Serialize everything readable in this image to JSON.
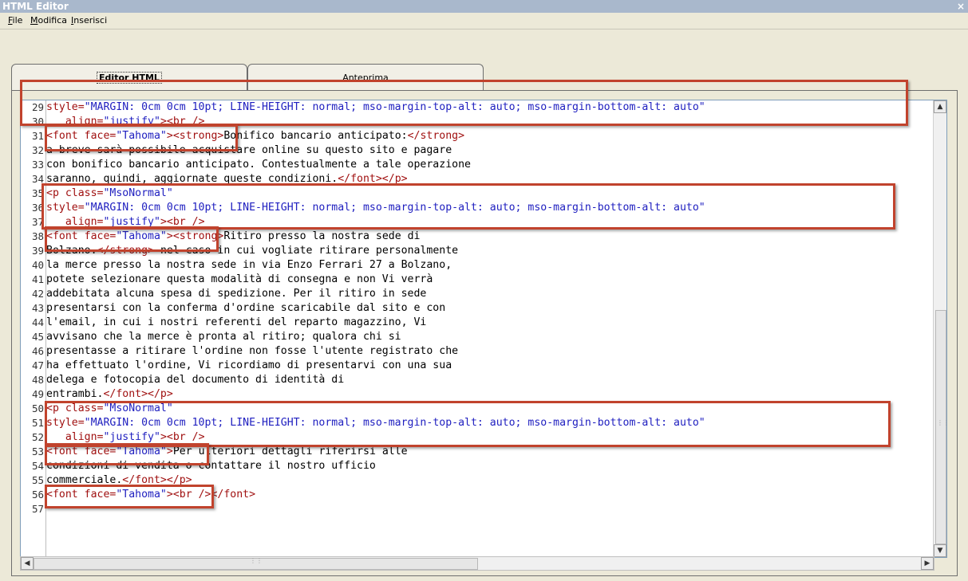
{
  "window": {
    "title": "HTML Editor",
    "close_glyph": "×"
  },
  "menu": [
    "File",
    "Modifica",
    "Inserisci"
  ],
  "tabs": [
    {
      "label": "Editor HTML",
      "active": true
    },
    {
      "label": "Anteprima",
      "active": false
    }
  ],
  "scroll": {
    "up": "▲",
    "down": "▼",
    "left": "◀",
    "right": "▶",
    "grip": "⋮⋮"
  },
  "editor_lines": [
    {
      "num": "29",
      "segs": [
        {
          "c": "attr",
          "t": "style="
        },
        {
          "c": "val",
          "t": "\"MARGIN: 0cm 0cm 10pt; LINE-HEIGHT: normal; mso-margin-top-alt: auto; mso-margin-bottom-alt: auto\""
        }
      ]
    },
    {
      "num": "30",
      "segs": [
        {
          "c": "attr",
          "t": "   align="
        },
        {
          "c": "val",
          "t": "\"justify\""
        },
        {
          "c": "tag",
          "t": "><br />"
        }
      ]
    },
    {
      "num": "31",
      "segs": [
        {
          "c": "tag",
          "t": "<font "
        },
        {
          "c": "attr",
          "t": "face="
        },
        {
          "c": "val",
          "t": "\"Tahoma\""
        },
        {
          "c": "tag",
          "t": "><strong>"
        },
        {
          "c": "txt",
          "t": "Bonifico bancario anticipato:"
        },
        {
          "c": "tag",
          "t": "</strong>"
        }
      ]
    },
    {
      "num": "32",
      "segs": [
        {
          "c": "txt",
          "t": "a breve sarà possibile acquistare online su questo sito e pagare"
        }
      ]
    },
    {
      "num": "33",
      "segs": [
        {
          "c": "txt",
          "t": "con bonifico bancario anticipato. Contestualmente a tale operazione"
        }
      ]
    },
    {
      "num": "34",
      "segs": [
        {
          "c": "txt",
          "t": "saranno, quindi, aggiornate queste condizioni."
        },
        {
          "c": "tag",
          "t": "</font></p>"
        }
      ]
    },
    {
      "num": "35",
      "segs": [
        {
          "c": "tag",
          "t": "<p "
        },
        {
          "c": "attr",
          "t": "class="
        },
        {
          "c": "val",
          "t": "\"MsoNormal\""
        }
      ]
    },
    {
      "num": "36",
      "segs": [
        {
          "c": "attr",
          "t": "style="
        },
        {
          "c": "val",
          "t": "\"MARGIN: 0cm 0cm 10pt; LINE-HEIGHT: normal; mso-margin-top-alt: auto; mso-margin-bottom-alt: auto\""
        }
      ]
    },
    {
      "num": "37",
      "segs": [
        {
          "c": "attr",
          "t": "   align="
        },
        {
          "c": "val",
          "t": "\"justify\""
        },
        {
          "c": "tag",
          "t": "><br />"
        }
      ]
    },
    {
      "num": "38",
      "segs": [
        {
          "c": "tag",
          "t": "<font "
        },
        {
          "c": "attr",
          "t": "face="
        },
        {
          "c": "val",
          "t": "\"Tahoma\""
        },
        {
          "c": "tag",
          "t": "><strong>"
        },
        {
          "c": "txt",
          "t": "Ritiro presso la nostra sede di"
        }
      ]
    },
    {
      "num": "39",
      "segs": [
        {
          "c": "txt",
          "t": "Bolzano."
        },
        {
          "c": "tag",
          "t": "</strong>"
        },
        {
          "c": "txt",
          "t": " nel caso in cui vogliate ritirare personalmente"
        }
      ]
    },
    {
      "num": "40",
      "segs": [
        {
          "c": "txt",
          "t": "la merce presso la nostra sede in via Enzo Ferrari 27 a Bolzano,"
        }
      ]
    },
    {
      "num": "41",
      "segs": [
        {
          "c": "txt",
          "t": "potete selezionare questa modalità di consegna e non Vi verrà"
        }
      ]
    },
    {
      "num": "42",
      "segs": [
        {
          "c": "txt",
          "t": "addebitata alcuna spesa di spedizione. Per il ritiro in sede"
        }
      ]
    },
    {
      "num": "43",
      "segs": [
        {
          "c": "txt",
          "t": "presentarsi con la conferma d'ordine scaricabile dal sito e con"
        }
      ]
    },
    {
      "num": "44",
      "segs": [
        {
          "c": "txt",
          "t": "l'email, in cui i nostri referenti del reparto magazzino, Vi"
        }
      ]
    },
    {
      "num": "45",
      "segs": [
        {
          "c": "txt",
          "t": "avvisano che la merce è pronta al ritiro; qualora chi si"
        }
      ]
    },
    {
      "num": "46",
      "segs": [
        {
          "c": "txt",
          "t": "presentasse a ritirare l'ordine non fosse l'utente registrato che"
        }
      ]
    },
    {
      "num": "47",
      "segs": [
        {
          "c": "txt",
          "t": "ha effettuato l'ordine, Vi ricordiamo di presentarvi con una sua"
        }
      ]
    },
    {
      "num": "48",
      "segs": [
        {
          "c": "txt",
          "t": "delega e fotocopia del documento di identità di"
        }
      ]
    },
    {
      "num": "49",
      "segs": [
        {
          "c": "txt",
          "t": "entrambi."
        },
        {
          "c": "tag",
          "t": "</font></p>"
        }
      ]
    },
    {
      "num": "50",
      "segs": [
        {
          "c": "tag",
          "t": "<p "
        },
        {
          "c": "attr",
          "t": "class="
        },
        {
          "c": "val",
          "t": "\"MsoNormal\""
        }
      ]
    },
    {
      "num": "51",
      "segs": [
        {
          "c": "attr",
          "t": "style="
        },
        {
          "c": "val",
          "t": "\"MARGIN: 0cm 0cm 10pt; LINE-HEIGHT: normal; mso-margin-top-alt: auto; mso-margin-bottom-alt: auto\""
        }
      ]
    },
    {
      "num": "52",
      "segs": [
        {
          "c": "attr",
          "t": "   align="
        },
        {
          "c": "val",
          "t": "\"justify\""
        },
        {
          "c": "tag",
          "t": "><br />"
        }
      ]
    },
    {
      "num": "53",
      "segs": [
        {
          "c": "tag",
          "t": "<font "
        },
        {
          "c": "attr",
          "t": "face="
        },
        {
          "c": "val",
          "t": "\"Tahoma\""
        },
        {
          "c": "tag",
          "t": ">"
        },
        {
          "c": "txt",
          "t": "Per ulteriori dettagli riferirsi alle"
        }
      ]
    },
    {
      "num": "54",
      "segs": [
        {
          "c": "txt",
          "t": "condizioni di vendita o contattare il nostro ufficio"
        }
      ]
    },
    {
      "num": "55",
      "segs": [
        {
          "c": "txt",
          "t": "commerciale."
        },
        {
          "c": "tag",
          "t": "</font></p>"
        }
      ]
    },
    {
      "num": "56",
      "segs": [
        {
          "c": "tag",
          "t": "<font "
        },
        {
          "c": "attr",
          "t": "face="
        },
        {
          "c": "val",
          "t": "\"Tahoma\""
        },
        {
          "c": "tag",
          "t": "><br /></font>"
        }
      ]
    },
    {
      "num": "57",
      "segs": []
    }
  ],
  "colors": {
    "highlight": "#c1432d",
    "tag": "#a01010",
    "value": "#2020c0"
  }
}
